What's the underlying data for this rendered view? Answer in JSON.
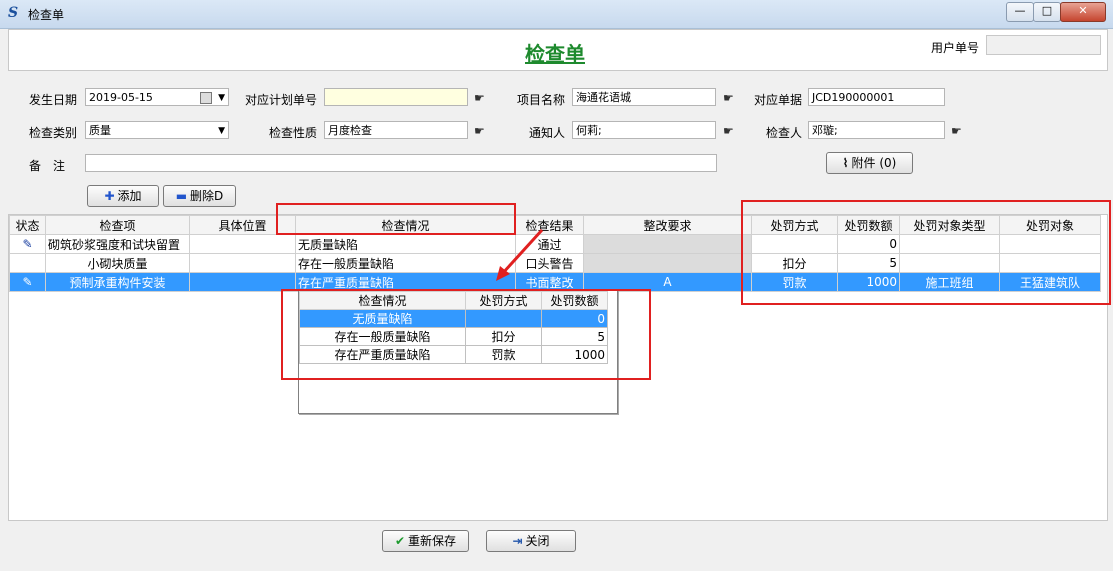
{
  "window": {
    "title": "检查单",
    "min": "—",
    "max": "□",
    "close": "✕"
  },
  "header": {
    "title": "检查单",
    "user_no_label": "用户单号",
    "user_no_value": ""
  },
  "form": {
    "date_label": "发生日期",
    "date_value": "2019-05-15",
    "plan_no_label": "对应计划单号",
    "plan_no_value": "",
    "project_label": "项目名称",
    "project_value": "海通花语城",
    "doc_label": "对应单据",
    "doc_value": "JCD190000001",
    "category_label": "检查类别",
    "category_value": "质量",
    "nature_label": "检查性质",
    "nature_value": "月度检查",
    "notify_label": "通知人",
    "notify_value": "何莉;",
    "inspector_label": "检查人",
    "inspector_value": "邓璇;",
    "remark_label": "备　注",
    "remark_value": "",
    "attach_label": "附件 (0)",
    "add_label": "添加",
    "delete_label": "删除D"
  },
  "grid": {
    "columns": [
      "状态",
      "检查项",
      "具体位置",
      "检查情况",
      "检查结果",
      "整改要求",
      "处罚方式",
      "处罚数额",
      "处罚对象类型",
      "处罚对象"
    ],
    "rows": [
      {
        "status": "✎",
        "item": "砌筑砂浆强度和试块留置",
        "location": "",
        "situation": "无质量缺陷",
        "result": "通过",
        "req": "",
        "method": "",
        "amount": "0",
        "target_type": "",
        "target": ""
      },
      {
        "status": "",
        "item": "小砌块质量",
        "location": "",
        "situation": "存在一般质量缺陷",
        "result": "口头警告",
        "req": "",
        "method": "扣分",
        "amount": "5",
        "target_type": "",
        "target": ""
      },
      {
        "status": "✎",
        "item": "预制承重构件安装",
        "location": "",
        "situation": "存在严重质量缺陷",
        "result": "书面整改",
        "req": "A",
        "method": "罚款",
        "amount": "1000",
        "target_type": "施工班组",
        "target": "王猛建筑队"
      }
    ]
  },
  "popup": {
    "columns": [
      "检查情况",
      "处罚方式",
      "处罚数额"
    ],
    "rows": [
      {
        "situation": "无质量缺陷",
        "method": "",
        "amount": "0"
      },
      {
        "situation": "存在一般质量缺陷",
        "method": "扣分",
        "amount": "5"
      },
      {
        "situation": "存在严重质量缺陷",
        "method": "罚款",
        "amount": "1000"
      }
    ]
  },
  "footer": {
    "save_label": "重新保存",
    "close_label": "关闭"
  },
  "colors": {
    "accent_title": "#1e8a2e",
    "selection": "#3399ff",
    "annotation": "#e02020",
    "plan_no_bg": "#ffffe0"
  }
}
